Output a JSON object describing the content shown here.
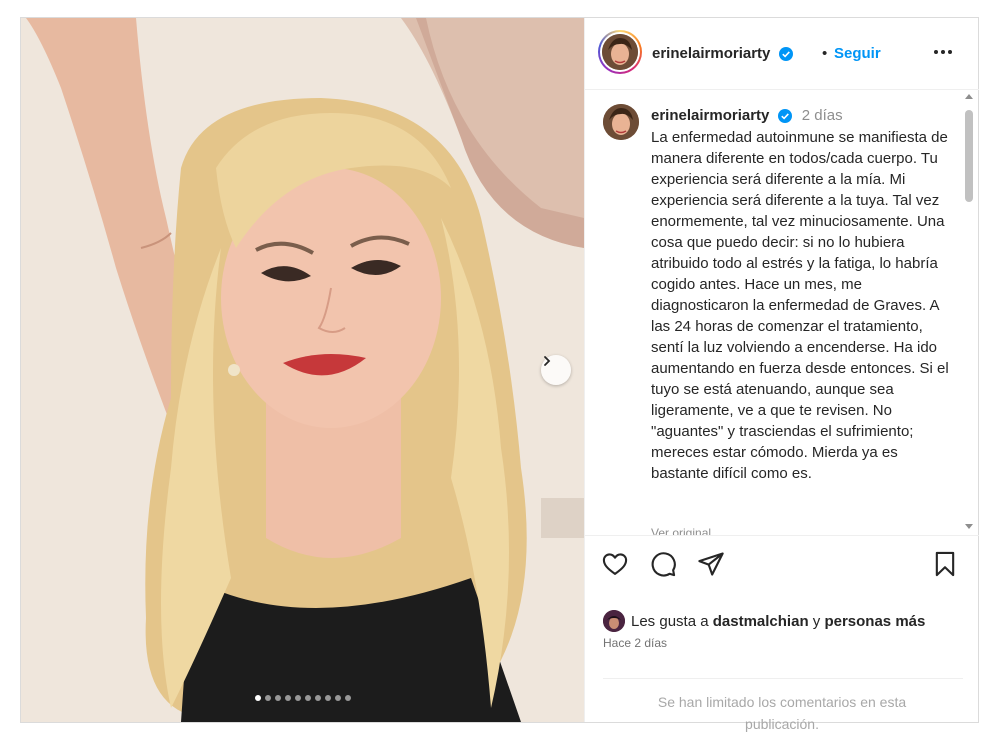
{
  "post": {
    "username": "erinelairmoriarty",
    "separator": "•",
    "follow_label": "Seguir",
    "more_icon": "more-options-icon",
    "verified_color": "#0095f6"
  },
  "carousel": {
    "total_slides": 10,
    "current_slide": 1,
    "next_icon": "chevron-right-icon"
  },
  "comment": {
    "username": "erinelairmoriarty",
    "time": "2 días",
    "caption": "La enfermedad autoinmune se manifiesta de manera diferente en todos/cada cuerpo. Tu experiencia será diferente a la mía. Mi experiencia será diferente a la tuya. Tal vez enormemente, tal vez minuciosamente. Una cosa que puedo decir: si no lo hubiera atribuido todo al estrés y la fatiga, lo habría cogido antes. Hace un mes, me diagnosticaron la enfermedad de Graves. A las 24 horas de comenzar el tratamiento, sentí la luz volviendo a encenderse. Ha ido aumentando en fuerza desde entonces. Si el tuyo se está atenuando, aunque sea ligeramente, ve a que te revisen. No \"aguantes\" y trasciendas el sufrimiento; mereces estar cómodo. Mierda ya es bastante difícil como es.",
    "see_original": "Ver original"
  },
  "actions": {
    "like_icon": "heart-icon",
    "comment_icon": "comment-icon",
    "share_icon": "share-icon",
    "save_icon": "bookmark-icon"
  },
  "likes": {
    "prefix": "Les gusta a",
    "user": "dastmalchian",
    "conjunction": "y",
    "suffix": "personas más"
  },
  "date_label": "Hace 2 días",
  "comments_limited": "Se han limitado los comentarios en esta publicación."
}
